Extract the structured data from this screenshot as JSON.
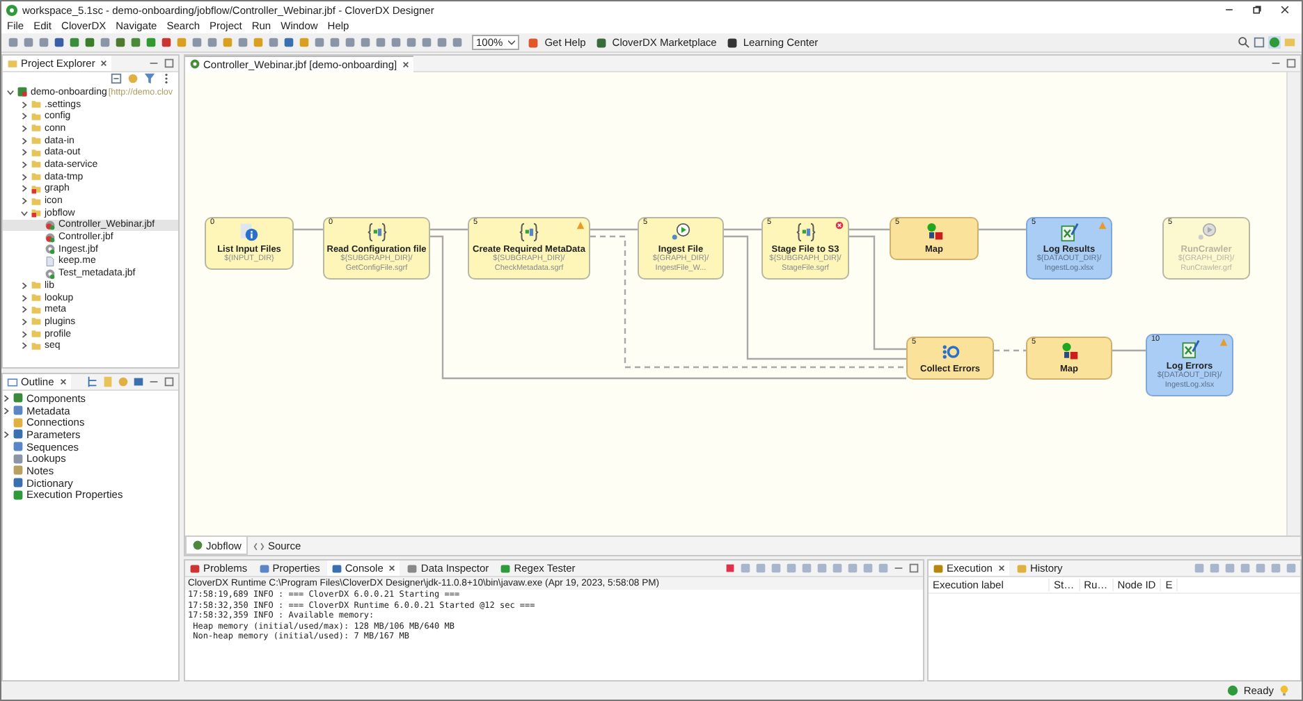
{
  "window": {
    "title": "workspace_5.1sc - demo-onboarding/jobflow/Controller_Webinar.jbf - CloverDX Designer"
  },
  "menu": [
    "File",
    "Edit",
    "CloverDX",
    "Navigate",
    "Search",
    "Project",
    "Run",
    "Window",
    "Help"
  ],
  "toolbar": {
    "zoom": "100%",
    "links": [
      "Get Help",
      "CloverDX Marketplace",
      "Learning Center"
    ]
  },
  "project_explorer": {
    "title": "Project Explorer",
    "tree": [
      {
        "label": "demo-onboarding",
        "note": "[http://demo.clov",
        "kind": "project",
        "selected": false,
        "expanded": true,
        "children": [
          {
            "label": ".settings",
            "kind": "folder",
            "selected": false,
            "expanded": false
          },
          {
            "label": "config",
            "kind": "folder",
            "selected": false,
            "expanded": false
          },
          {
            "label": "conn",
            "kind": "folder",
            "selected": false,
            "expanded": false
          },
          {
            "label": "data-in",
            "kind": "folder",
            "selected": false,
            "expanded": false
          },
          {
            "label": "data-out",
            "kind": "folder",
            "selected": false,
            "expanded": false
          },
          {
            "label": "data-service",
            "kind": "folder",
            "selected": false,
            "expanded": false
          },
          {
            "label": "data-tmp",
            "kind": "folder",
            "selected": false,
            "expanded": false
          },
          {
            "label": "graph",
            "kind": "marked-folder",
            "selected": false,
            "expanded": false
          },
          {
            "label": "icon",
            "kind": "folder",
            "selected": false,
            "expanded": false
          },
          {
            "label": "jobflow",
            "kind": "marked-folder",
            "selected": false,
            "expanded": true,
            "children": [
              {
                "label": "Controller_Webinar.jbf",
                "kind": "jobflow",
                "selected": true
              },
              {
                "label": "Controller.jbf",
                "kind": "jobflow",
                "selected": false
              },
              {
                "label": "Ingest.jbf",
                "kind": "graph",
                "selected": false
              },
              {
                "label": "keep.me",
                "kind": "text",
                "selected": false
              },
              {
                "label": "Test_metadata.jbf",
                "kind": "graph",
                "selected": false
              }
            ]
          },
          {
            "label": "lib",
            "kind": "folder",
            "selected": false,
            "expanded": false
          },
          {
            "label": "lookup",
            "kind": "folder",
            "selected": false,
            "expanded": false
          },
          {
            "label": "meta",
            "kind": "folder",
            "selected": false,
            "expanded": false
          },
          {
            "label": "plugins",
            "kind": "folder",
            "selected": false,
            "expanded": false
          },
          {
            "label": "profile",
            "kind": "folder",
            "selected": false,
            "expanded": false
          },
          {
            "label": "seq",
            "kind": "folder",
            "selected": false,
            "expanded": false
          }
        ]
      }
    ]
  },
  "outline": {
    "title": "Outline",
    "items": [
      {
        "label": "Components",
        "collapsible": true
      },
      {
        "label": "Metadata",
        "collapsible": true
      },
      {
        "label": "Connections",
        "collapsible": false
      },
      {
        "label": "Parameters",
        "collapsible": true
      },
      {
        "label": "Sequences",
        "collapsible": false
      },
      {
        "label": "Lookups",
        "collapsible": false
      },
      {
        "label": "Notes",
        "collapsible": false
      },
      {
        "label": "Dictionary",
        "collapsible": false
      },
      {
        "label": "Execution Properties",
        "collapsible": false
      }
    ]
  },
  "editor": {
    "tab": "Controller_Webinar.jbf [demo-onboarding]",
    "nodes": [
      {
        "phase": "0",
        "title": "List Input Files",
        "path": [
          "${INPUT_DIR}"
        ],
        "kind": "info",
        "disabled": false,
        "warning": false,
        "error": false
      },
      {
        "phase": "0",
        "title": "Read Configuration file",
        "path": [
          "${SUBGRAPH_DIR}/",
          "GetConfigFile.sgrf"
        ],
        "kind": "subgraph",
        "disabled": false,
        "warning": false,
        "error": false
      },
      {
        "phase": "5",
        "title": "Create Required MetaData",
        "path": [
          "${SUBGRAPH_DIR}/",
          "CheckMetadata.sgrf"
        ],
        "kind": "subgraph",
        "disabled": false,
        "warning": true,
        "error": false
      },
      {
        "phase": "5",
        "title": "Ingest File",
        "path": [
          "${GRAPH_DIR}/",
          "IngestFile_W..."
        ],
        "kind": "run",
        "disabled": false,
        "warning": false,
        "error": false
      },
      {
        "phase": "5",
        "title": "Stage File to S3",
        "path": [
          "${SUBGRAPH_DIR}/",
          "StageFile.sgrf"
        ],
        "kind": "subgraph",
        "disabled": false,
        "warning": false,
        "error": true
      },
      {
        "phase": "5",
        "title": "Map",
        "kind": "map",
        "disabled": false,
        "warning": false,
        "error": false
      },
      {
        "phase": "5",
        "title": "Log Results",
        "path": [
          "${DATAOUT_DIR}/",
          "IngestLog.xlsx"
        ],
        "kind": "excel",
        "disabled": false,
        "warning": true,
        "error": false
      },
      {
        "phase": "5",
        "title": "RunCrawler",
        "path": [
          "${GRAPH_DIR}/",
          "RunCrawler.grf"
        ],
        "kind": "run",
        "disabled": true,
        "warning": false,
        "error": false
      },
      {
        "phase": "5",
        "title": "Collect Errors",
        "kind": "collect",
        "disabled": false,
        "warning": false,
        "error": false
      },
      {
        "phase": "5",
        "title": "Map",
        "kind": "map",
        "disabled": false,
        "warning": false,
        "error": false
      },
      {
        "phase": "10",
        "title": "Log Errors",
        "path": [
          "${DATAOUT_DIR}/",
          "IngestLog.xlsx"
        ],
        "kind": "excel",
        "disabled": false,
        "warning": true,
        "error": false
      }
    ],
    "bottom_tabs": [
      {
        "label": "Jobflow",
        "selected": true
      },
      {
        "label": "Source",
        "selected": false
      }
    ]
  },
  "console": {
    "tabs": [
      {
        "label": "Problems",
        "selected": false
      },
      {
        "label": "Properties",
        "selected": false
      },
      {
        "label": "Console",
        "selected": true
      },
      {
        "label": "Data Inspector",
        "selected": false
      },
      {
        "label": "Regex Tester",
        "selected": false
      }
    ],
    "header": "CloverDX Runtime C:\\Program Files\\CloverDX Designer\\jdk-11.0.8+10\\bin\\javaw.exe (Apr 19, 2023, 5:58:08 PM)",
    "lines": [
      "17:58:19,689 INFO : === CloverDX 6.0.0.21 Starting ===",
      "17:58:32,350 INFO : === CloverDX Runtime 6.0.0.21 Started @12 sec ===",
      "17:58:32,359 INFO : Available memory:",
      " Heap memory (initial/used/max): 128 MB/106 MB/640 MB",
      " Non-heap memory (initial/used): 7 MB/167 MB"
    ]
  },
  "execution": {
    "tabs": [
      {
        "label": "Execution",
        "selected": true
      },
      {
        "label": "History",
        "selected": false
      }
    ],
    "columns": [
      "Execution label",
      "St…",
      "Ru…",
      "Node ID",
      "E"
    ]
  },
  "status_bar": {
    "text": "Ready"
  }
}
